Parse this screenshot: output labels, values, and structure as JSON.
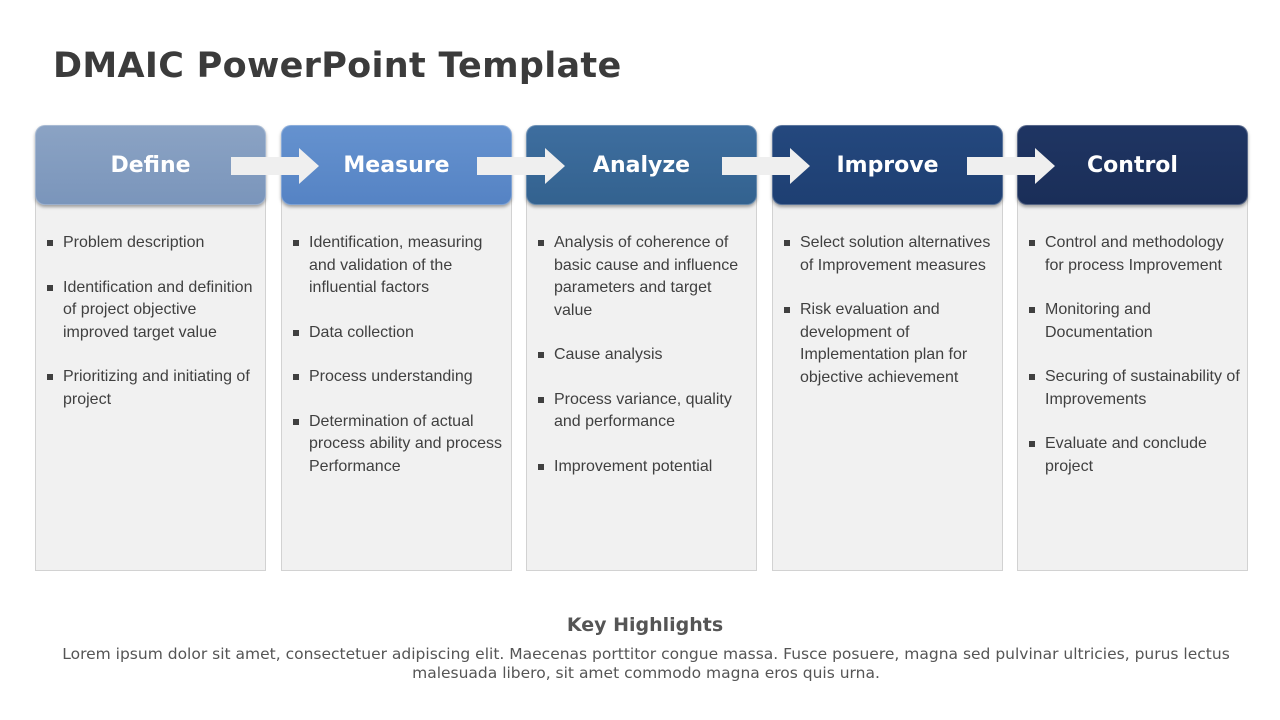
{
  "slide": {
    "title": "DMAIC PowerPoint Template"
  },
  "phases": [
    {
      "label": "Define",
      "color_top": "#8ba3c4",
      "color_bottom": "#7a95bb",
      "items": [
        "Problem description",
        "Identification and definition of project objective improved target value",
        "Prioritizing and initiating of project"
      ]
    },
    {
      "label": "Measure",
      "color_top": "#6592cf",
      "color_bottom": "#5583c4",
      "items": [
        "Identification, measuring and validation of the influential factors",
        "Data collection",
        "Process understanding",
        "Determination of actual process ability and process Performance"
      ]
    },
    {
      "label": "Analyze",
      "color_top": "#3e6e9f",
      "color_bottom": "#33628f",
      "items": [
        "Analysis of coherence of basic cause and influence parameters and target value",
        "Cause analysis",
        "Process variance, quality and performance",
        "Improvement potential"
      ]
    },
    {
      "label": "Improve",
      "color_top": "#24487e",
      "color_bottom": "#1e3f72",
      "items": [
        "Select solution alternatives of Improvement measures",
        "Risk evaluation and development of Implementation plan for objective achievement"
      ]
    },
    {
      "label": "Control",
      "color_top": "#1f3563",
      "color_bottom": "#1a2e58",
      "items": [
        "Control and methodology for process Improvement",
        "Monitoring and Documentation",
        "Securing of sustainability of Improvements",
        "Evaluate and conclude project"
      ]
    }
  ],
  "arrow_icon": "right-arrow-icon",
  "arrow_color": "#efefef",
  "highlights": {
    "title": "Key Highlights",
    "body": "Lorem ipsum dolor sit amet, consectetuer adipiscing elit. Maecenas porttitor congue massa. Fusce posuere, magna sed pulvinar ultricies, purus lectus malesuada libero, sit amet commodo magna eros quis urna."
  }
}
